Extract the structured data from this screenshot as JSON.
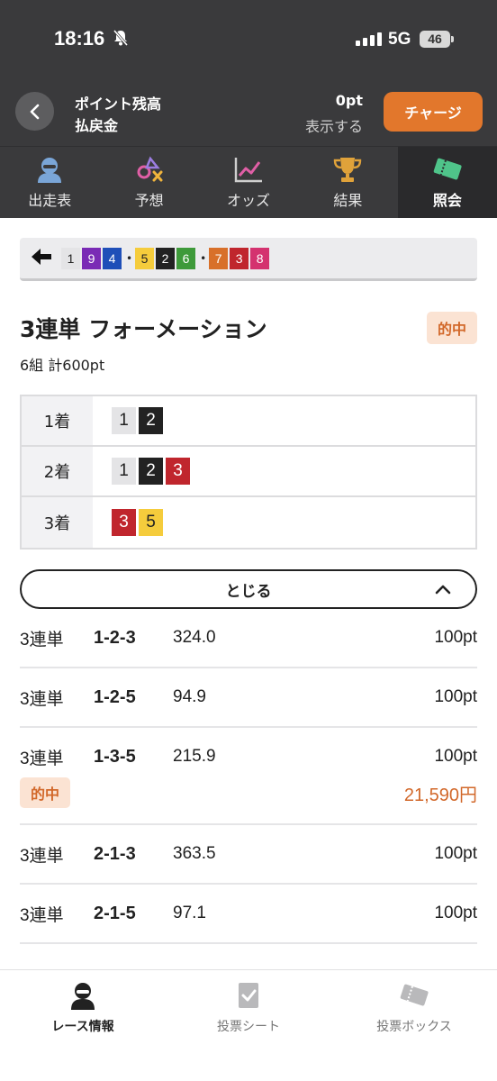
{
  "status_bar": {
    "time": "18:16",
    "network": "5G",
    "battery": "46"
  },
  "header": {
    "points_label": "ポイント残高",
    "refund_label": "払戻金",
    "points_value": "0pt",
    "show_label": "表示する",
    "charge_label": "チャージ",
    "accent_color": "#e2772c"
  },
  "tabs": [
    {
      "label": "出走表",
      "icon": "racer-icon",
      "active": false
    },
    {
      "label": "予想",
      "icon": "prediction-icon",
      "active": false
    },
    {
      "label": "オッズ",
      "icon": "chart-icon",
      "active": false
    },
    {
      "label": "結果",
      "icon": "trophy-icon",
      "active": false
    },
    {
      "label": "照会",
      "icon": "ticket-icon",
      "active": true
    }
  ],
  "summary": {
    "groups": [
      [
        {
          "n": "1",
          "bg": "#e4e4e6",
          "fg": "#222"
        },
        {
          "n": "9",
          "bg": "#7a2bb5",
          "fg": "#fff"
        },
        {
          "n": "4",
          "bg": "#1f4fb8",
          "fg": "#fff"
        }
      ],
      [
        {
          "n": "5",
          "bg": "#f5cc3c",
          "fg": "#222"
        },
        {
          "n": "2",
          "bg": "#222",
          "fg": "#fff"
        },
        {
          "n": "6",
          "bg": "#3e9a3a",
          "fg": "#fff"
        }
      ],
      [
        {
          "n": "7",
          "bg": "#d8702a",
          "fg": "#fff"
        },
        {
          "n": "3",
          "bg": "#c0262d",
          "fg": "#fff"
        },
        {
          "n": "8",
          "bg": "#d4326f",
          "fg": "#fff"
        }
      ]
    ]
  },
  "bet": {
    "title": "3連単 フォーメーション",
    "hit_label": "的中",
    "sub": "6組 計600pt",
    "rows": [
      {
        "label": "1着",
        "nums": [
          {
            "n": "1",
            "bg": "#e4e4e6",
            "fg": "#222"
          },
          {
            "n": "2",
            "bg": "#222",
            "fg": "#fff"
          }
        ]
      },
      {
        "label": "2着",
        "nums": [
          {
            "n": "1",
            "bg": "#e4e4e6",
            "fg": "#222"
          },
          {
            "n": "2",
            "bg": "#222",
            "fg": "#fff"
          },
          {
            "n": "3",
            "bg": "#c0262d",
            "fg": "#fff"
          }
        ]
      },
      {
        "label": "3着",
        "nums": [
          {
            "n": "3",
            "bg": "#c0262d",
            "fg": "#fff"
          },
          {
            "n": "5",
            "bg": "#f5cc3c",
            "fg": "#222"
          }
        ]
      }
    ],
    "close_label": "とじる"
  },
  "results": [
    {
      "type": "3連単",
      "combo": "1-2-3",
      "odds": "324.0",
      "stake": "100pt",
      "hit": false,
      "payout": ""
    },
    {
      "type": "3連単",
      "combo": "1-2-5",
      "odds": "94.9",
      "stake": "100pt",
      "hit": false,
      "payout": ""
    },
    {
      "type": "3連単",
      "combo": "1-3-5",
      "odds": "215.9",
      "stake": "100pt",
      "hit": true,
      "hit_label": "的中",
      "payout": "21,590円"
    },
    {
      "type": "3連単",
      "combo": "2-1-3",
      "odds": "363.5",
      "stake": "100pt",
      "hit": false,
      "payout": ""
    },
    {
      "type": "3連単",
      "combo": "2-1-5",
      "odds": "97.1",
      "stake": "100pt",
      "hit": false,
      "payout": ""
    }
  ],
  "bottom_nav": [
    {
      "label": "レース情報",
      "icon": "racer-icon",
      "active": true
    },
    {
      "label": "投票シート",
      "icon": "check-sheet-icon",
      "active": false
    },
    {
      "label": "投票ボックス",
      "icon": "ticket-box-icon",
      "active": false
    }
  ]
}
